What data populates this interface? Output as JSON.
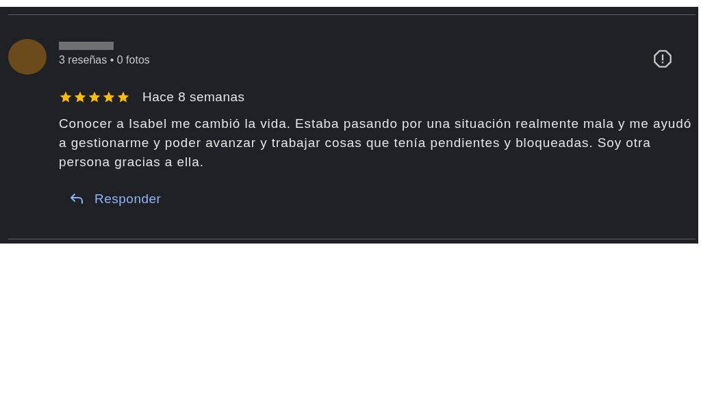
{
  "review": {
    "reviewer_stats": "3 reseñas • 0 fotos",
    "stars": 5,
    "time": "Hace 8 semanas",
    "text": "Conocer a Isabel me cambió la vida. Estaba pasando por una situación realmente mala y me ayudó a gestionarme y poder avanzar y trabajar cosas que tenía pendientes y bloqueadas. Soy otra persona gracias a ella.",
    "reply_label": "Responder"
  }
}
